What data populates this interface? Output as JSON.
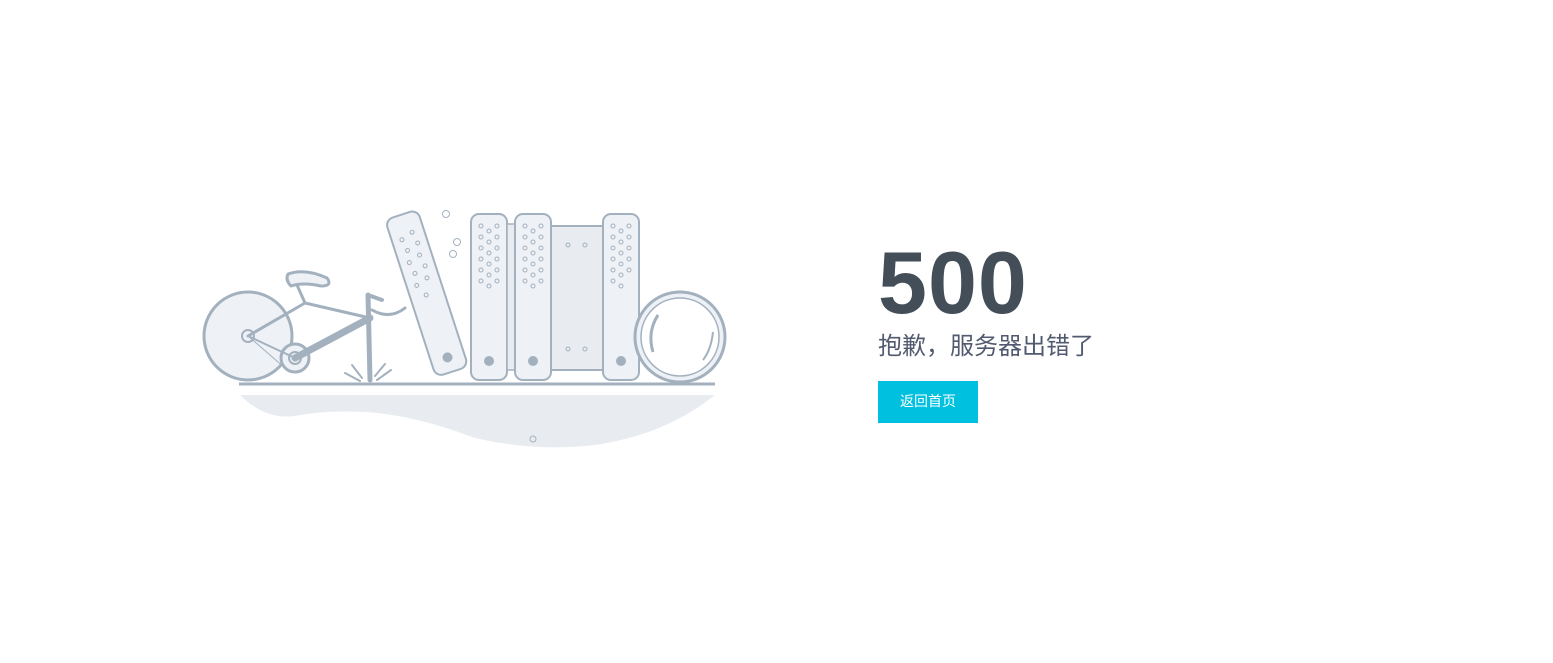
{
  "error": {
    "code": "500",
    "message": "抱歉，服务器出错了"
  },
  "actions": {
    "home_label": "返回首页"
  },
  "colors": {
    "accent": "#00c0e0",
    "heading": "#434e59",
    "illustration_stroke": "#a3b1bf",
    "illustration_fill": "#eef1f5"
  },
  "illustration": {
    "icon": "broken-bicycle-and-binders-illustration"
  }
}
